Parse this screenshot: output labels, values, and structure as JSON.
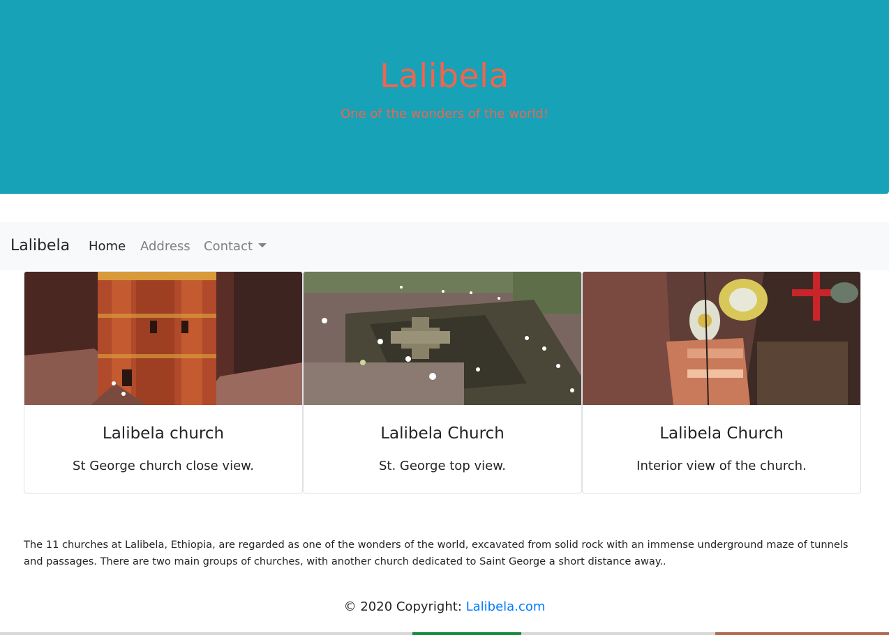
{
  "hero": {
    "title": "Lalibela",
    "subtitle": "One of the wonders of the world!"
  },
  "navbar": {
    "brand": "Lalibela",
    "links": [
      {
        "label": "Home",
        "active": true
      },
      {
        "label": "Address",
        "active": false
      },
      {
        "label": "Contact",
        "active": false,
        "dropdown": true
      }
    ]
  },
  "cards": [
    {
      "title": "Lalibela church",
      "text": "St George church close view.",
      "image": "church-close-view"
    },
    {
      "title": "Lalibela Church",
      "text": "St. George top view.",
      "image": "church-top-view"
    },
    {
      "title": "Lalibela Church",
      "text": "Interior view of the church.",
      "image": "church-interior-view"
    }
  ],
  "description": "The 11 churches at Lalibela, Ethiopia, are regarded as one of the wonders of the world, excavated from solid rock with an immense underground maze of tunnels and passages. There are two main groups of churches, with another church dedicated to Saint George a short distance away..",
  "footer": {
    "copyright": "© 2020 Copyright: ",
    "link": "Lalibela.com"
  },
  "colors": {
    "hero_bg": "#17a2b8",
    "hero_text": "#f0654e",
    "navbar_bg": "#f8f9fa",
    "link": "#007bff"
  }
}
